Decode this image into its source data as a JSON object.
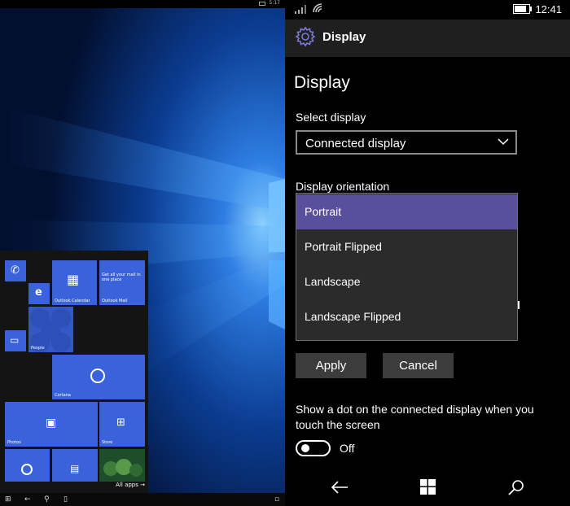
{
  "left_panel": {
    "status_time": "5:17",
    "tiles": {
      "outlook_calendar": "Outlook Calendar",
      "outlook_mail": "Outlook Mail",
      "mail_preview": "Get all your mail in one place",
      "people": "People",
      "cortana": "Cortana",
      "photos": "Photos",
      "store": "Store"
    },
    "all_apps": "All apps →"
  },
  "status": {
    "time": "12:41"
  },
  "header": {
    "title": "Display"
  },
  "page": {
    "heading": "Display",
    "select_display_label": "Select display",
    "selected_display": "Connected display",
    "orientation_label": "Display orientation",
    "orientation_options": [
      "Portrait",
      "Portrait Flipped",
      "Landscape",
      "Landscape Flipped"
    ],
    "orientation_selected_index": 0,
    "apply_label": "Apply",
    "cancel_label": "Cancel",
    "dot_setting_text": "Show a dot on the connected display when you touch the screen",
    "toggle_state": "Off",
    "toggle_on": false
  },
  "colors": {
    "accent": "#5a4f9c",
    "tile_blue": "#3a63db",
    "header_bg": "#1f1f1f",
    "button_bg": "#3c3c3c"
  },
  "icons": {
    "header": "gear-icon",
    "nav": [
      "back-icon",
      "windows-icon",
      "search-icon"
    ]
  }
}
